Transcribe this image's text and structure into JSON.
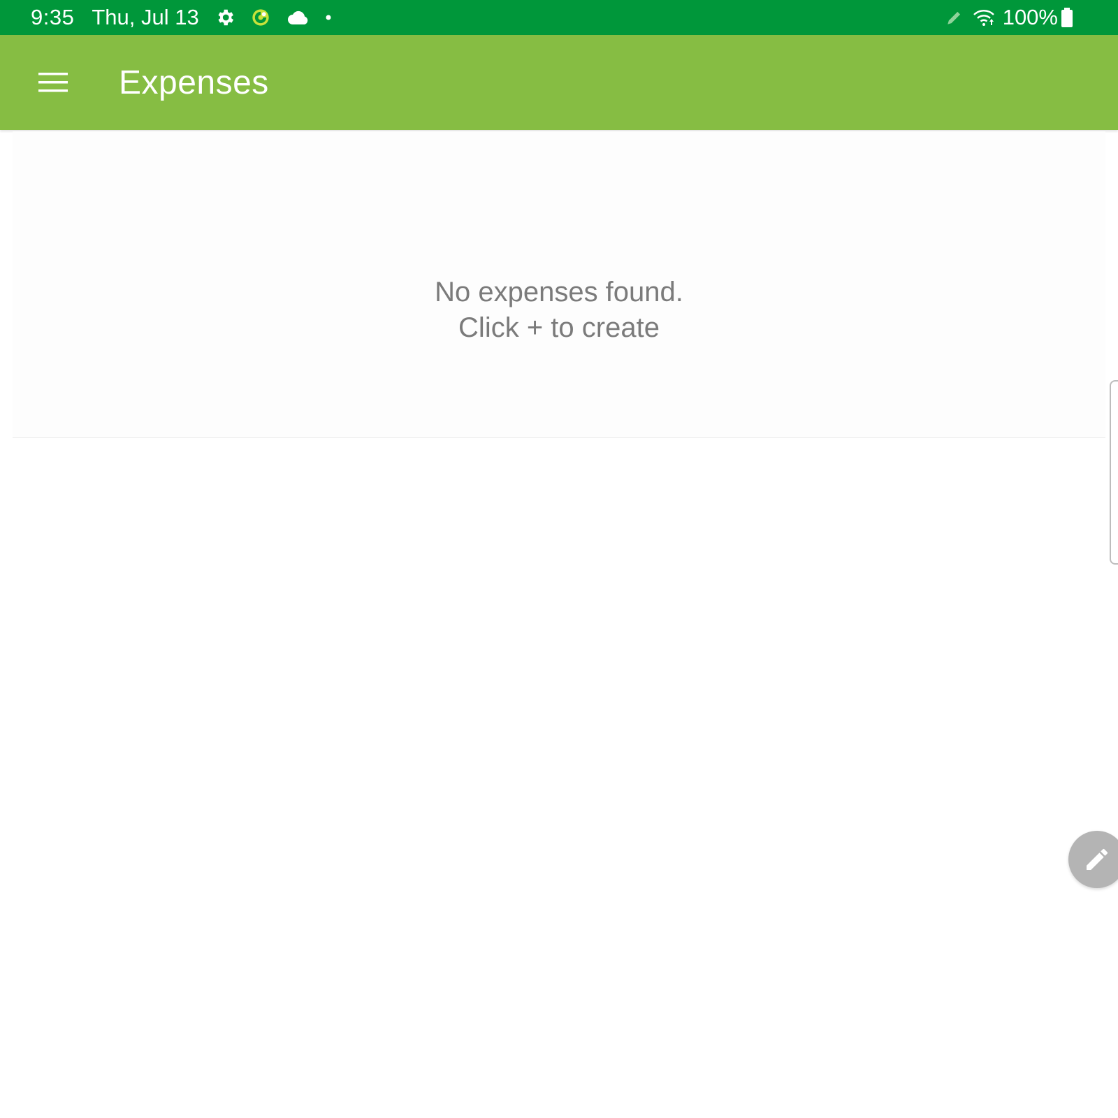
{
  "status_bar": {
    "time": "9:35",
    "date": "Thu, Jul 13",
    "icons": [
      "gear-icon",
      "app-notification-icon",
      "cloud-icon",
      "dot-icon",
      "pen-icon",
      "wifi-icon",
      "battery-icon"
    ],
    "battery": "100%"
  },
  "app_bar": {
    "menu_icon": "hamburger-menu-icon",
    "title": "Expenses",
    "color": "#86bd43"
  },
  "empty_state": {
    "line1": "No expenses found.",
    "line2": "Click + to create"
  },
  "fab": {
    "icon": "pencil-icon"
  },
  "colors": {
    "status_bar": "#00973a",
    "app_bar": "#86bd43",
    "empty_text": "#7b7b7b",
    "fab": "#b4b4b4"
  }
}
